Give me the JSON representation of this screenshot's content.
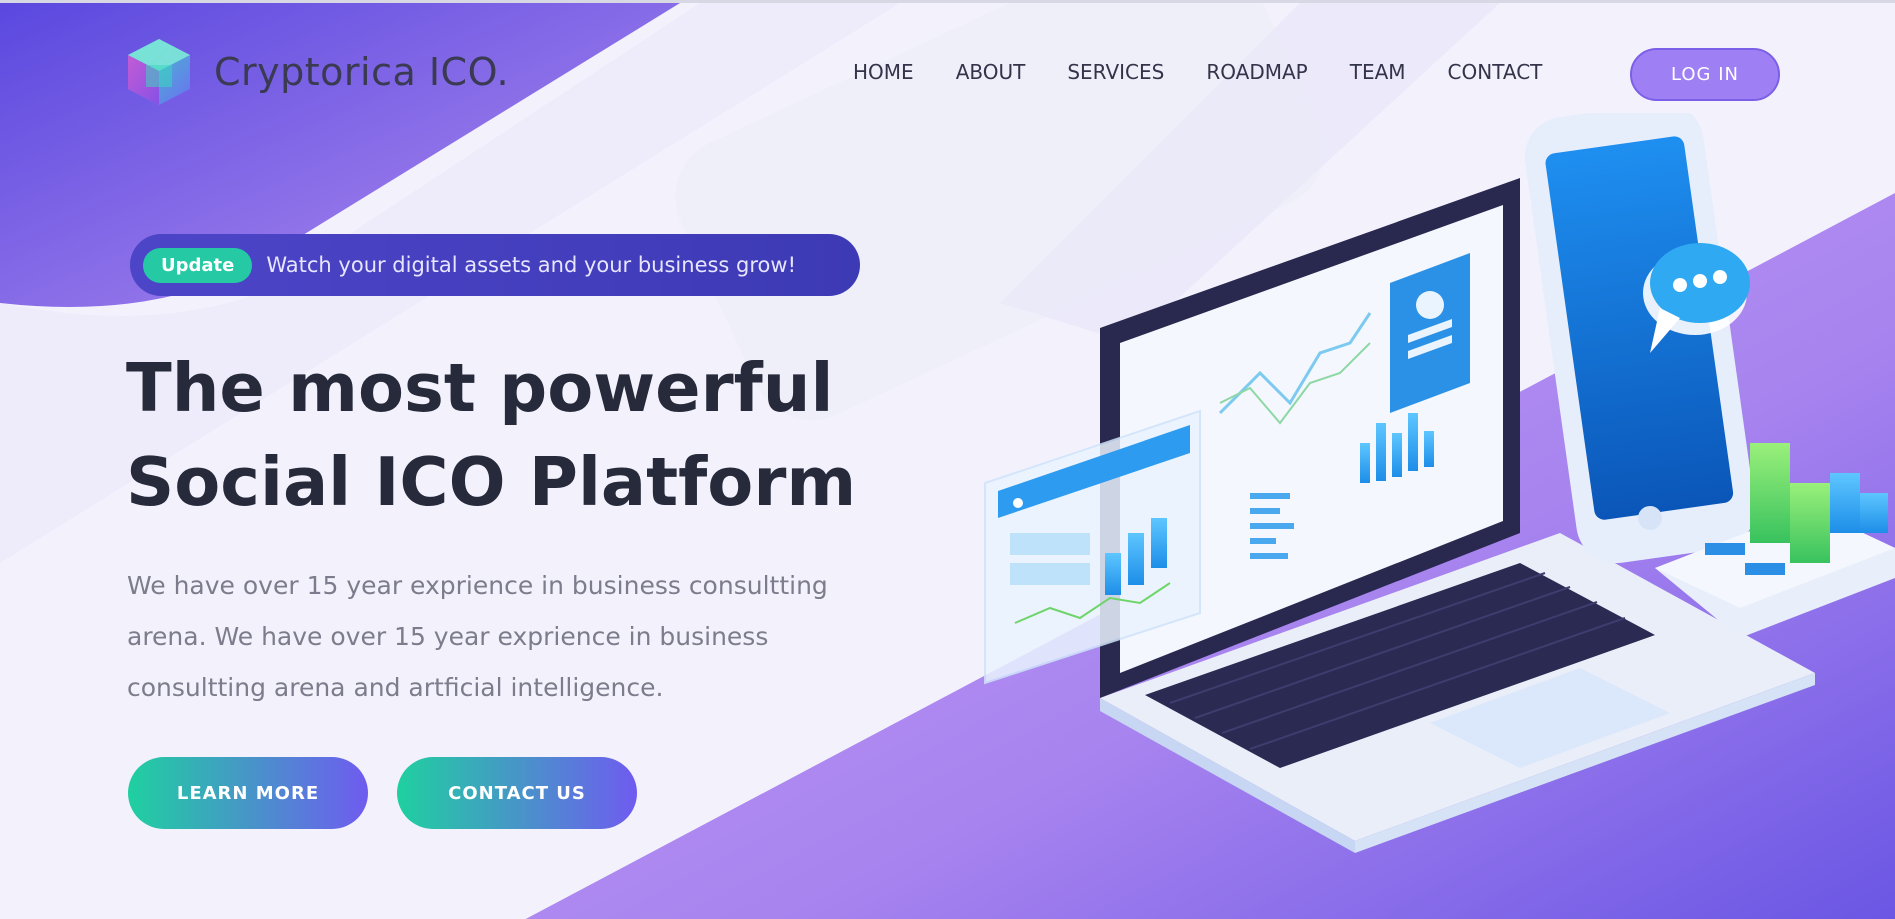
{
  "brand": {
    "name": "Cryptorica ICO."
  },
  "nav": {
    "items": [
      {
        "label": "HOME"
      },
      {
        "label": "ABOUT"
      },
      {
        "label": "SERVICES"
      },
      {
        "label": "ROADMAP"
      },
      {
        "label": "TEAM"
      },
      {
        "label": "CONTACT"
      }
    ],
    "login_label": "LOG IN"
  },
  "hero": {
    "badge": "Update",
    "announcement": "Watch your digital assets and your business grow!",
    "title_line1": "The most powerful",
    "title_line2": "Social ICO Platform",
    "description": "We have over 15 year exprience in business consultting arena. We have over 15 year exprience in business consultting arena and artficial intelligence.",
    "learn_more_label": "LEARN MORE",
    "contact_us_label": "CONTACT US"
  },
  "colors": {
    "accent": "#9f80f4",
    "badge": "#25c9a4",
    "heading": "#262a3b",
    "gradient_start": "#1fd0a0",
    "gradient_end": "#6f5bf0"
  }
}
